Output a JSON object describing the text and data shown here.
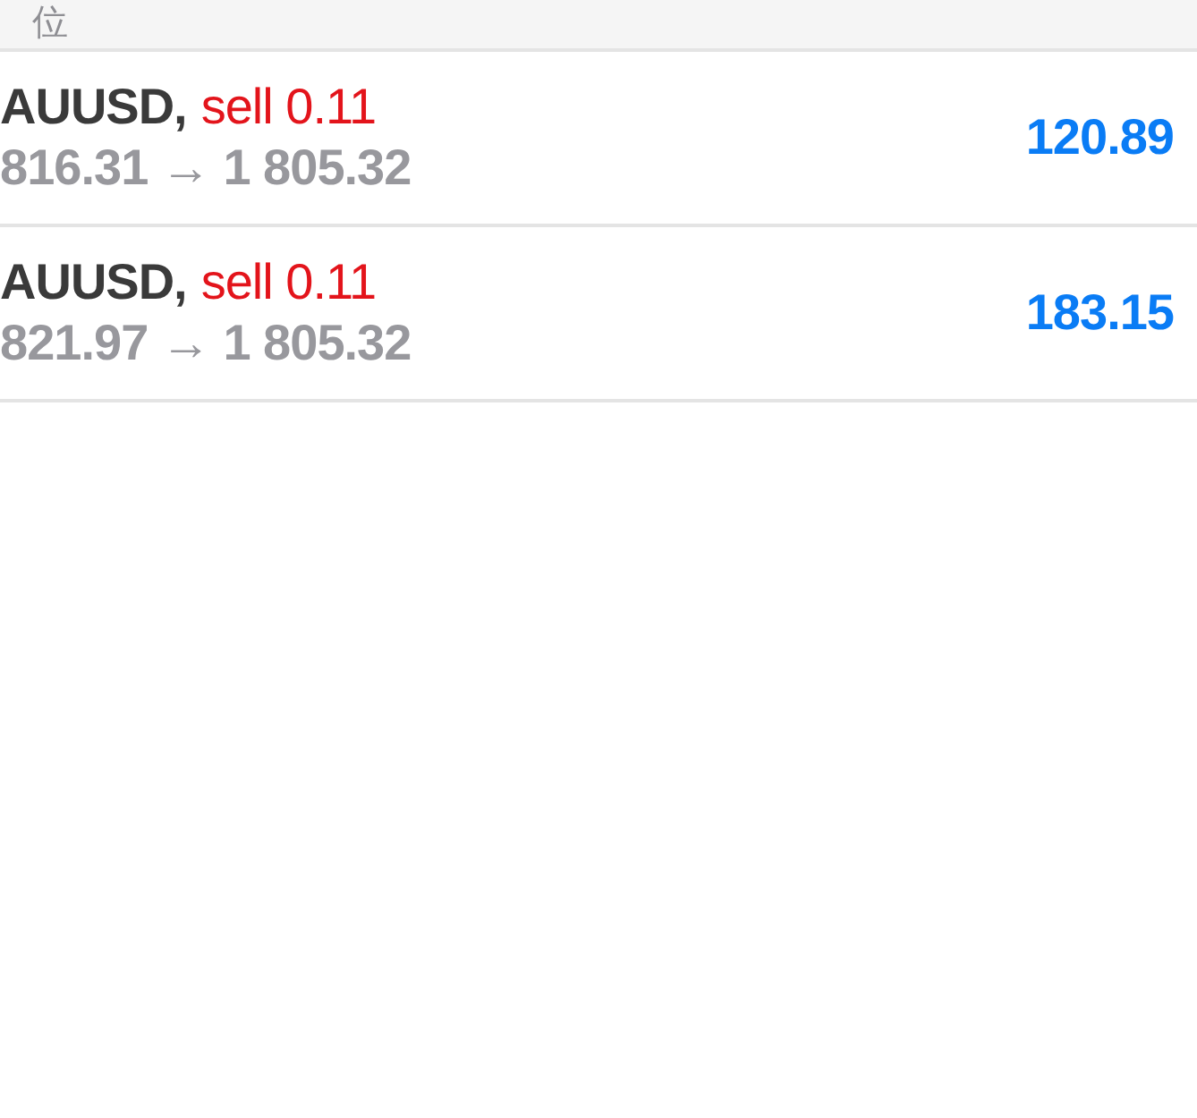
{
  "header": {
    "title": "位"
  },
  "positions": [
    {
      "symbol": "AUUSD,",
      "order": "sell 0.11",
      "prices": "816.31 → 1 805.32",
      "profit": "120.89"
    },
    {
      "symbol": "AUUSD,",
      "order": "sell 0.11",
      "prices": "821.97 → 1 805.32",
      "profit": "183.15"
    }
  ]
}
